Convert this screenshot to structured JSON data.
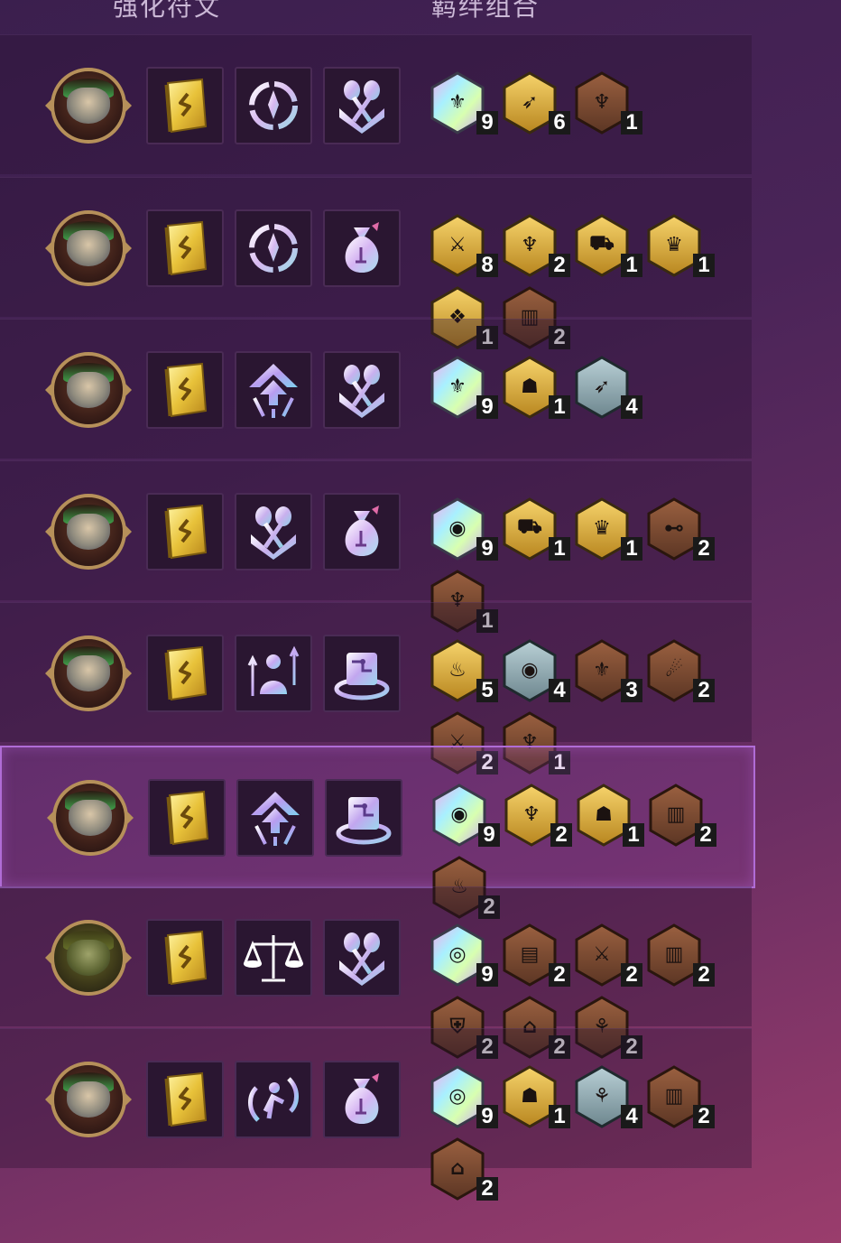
{
  "header": {
    "col_augments": "强化符文",
    "col_traits": "羁绊组合"
  },
  "colors": {
    "prismatic": "prismatic",
    "gold": "#d8a63a",
    "bronze": "#7a4a34",
    "silver": "#8fa6ad"
  },
  "rows": [
    {
      "selected": false,
      "avatar": "champion-portrait",
      "augments": [
        "book-icon",
        "ring-sigil-icon",
        "crossed-tools-icon"
      ],
      "traits": [
        {
          "tier": "prismatic",
          "glyph": "claw",
          "count": "9"
        },
        {
          "tier": "gold",
          "glyph": "feather",
          "count": "6"
        },
        {
          "tier": "bronze",
          "glyph": "beast",
          "count": "1"
        }
      ]
    },
    {
      "selected": false,
      "avatar": "champion-portrait",
      "augments": [
        "book-icon",
        "ring-sigil-icon",
        "money-bag-icon"
      ],
      "traits": [
        {
          "tier": "gold",
          "glyph": "blade",
          "count": "8"
        },
        {
          "tier": "gold",
          "glyph": "beast",
          "count": "2"
        },
        {
          "tier": "gold",
          "glyph": "cannon",
          "count": "1"
        },
        {
          "tier": "gold",
          "glyph": "queen",
          "count": "1"
        },
        {
          "tier": "gold",
          "glyph": "rune",
          "count": "1"
        },
        {
          "tier": "bronze",
          "glyph": "pillars",
          "count": "2"
        }
      ]
    },
    {
      "selected": false,
      "avatar": "champion-portrait",
      "augments": [
        "book-icon",
        "arrow-up-icon",
        "crossed-tools-icon"
      ],
      "traits": [
        {
          "tier": "prismatic",
          "glyph": "claw",
          "count": "9"
        },
        {
          "tier": "gold",
          "glyph": "mask",
          "count": "1"
        },
        {
          "tier": "silver",
          "glyph": "feather",
          "count": "4"
        }
      ]
    },
    {
      "selected": false,
      "avatar": "champion-portrait",
      "augments": [
        "book-icon",
        "crossed-tools-icon",
        "money-bag-icon"
      ],
      "traits": [
        {
          "tier": "prismatic",
          "glyph": "eye",
          "count": "9"
        },
        {
          "tier": "gold",
          "glyph": "cannon",
          "count": "1"
        },
        {
          "tier": "gold",
          "glyph": "queen",
          "count": "1"
        },
        {
          "tier": "bronze",
          "glyph": "dumbbell",
          "count": "2"
        },
        {
          "tier": "bronze",
          "glyph": "beast",
          "count": "1"
        }
      ]
    },
    {
      "selected": false,
      "avatar": "champion-portrait",
      "augments": [
        "book-icon",
        "person-arrows-icon",
        "hat-chip-icon"
      ],
      "traits": [
        {
          "tier": "gold",
          "glyph": "flame",
          "count": "5"
        },
        {
          "tier": "silver",
          "glyph": "eye",
          "count": "4"
        },
        {
          "tier": "bronze",
          "glyph": "claw",
          "count": "3"
        },
        {
          "tier": "bronze",
          "glyph": "comet",
          "count": "2"
        },
        {
          "tier": "bronze",
          "glyph": "blade",
          "count": "2"
        },
        {
          "tier": "bronze",
          "glyph": "beast",
          "count": "1"
        }
      ]
    },
    {
      "selected": true,
      "avatar": "champion-portrait",
      "augments": [
        "book-icon",
        "arrow-up-icon",
        "hat-chip-icon"
      ],
      "traits": [
        {
          "tier": "prismatic",
          "glyph": "eye",
          "count": "9"
        },
        {
          "tier": "gold",
          "glyph": "beast",
          "count": "2"
        },
        {
          "tier": "gold",
          "glyph": "mask",
          "count": "1"
        },
        {
          "tier": "bronze",
          "glyph": "pillars",
          "count": "2"
        },
        {
          "tier": "bronze",
          "glyph": "flame",
          "count": "2"
        }
      ]
    },
    {
      "selected": false,
      "avatar": "champion-portrait-alt",
      "augments": [
        "book-icon",
        "scales-icon",
        "crossed-tools-icon"
      ],
      "traits": [
        {
          "tier": "prismatic",
          "glyph": "swirl",
          "count": "9"
        },
        {
          "tier": "bronze",
          "glyph": "book",
          "count": "2"
        },
        {
          "tier": "bronze",
          "glyph": "blade",
          "count": "2"
        },
        {
          "tier": "bronze",
          "glyph": "pillars",
          "count": "2"
        },
        {
          "tier": "bronze",
          "glyph": "shield",
          "count": "2"
        },
        {
          "tier": "bronze",
          "glyph": "arch",
          "count": "2"
        },
        {
          "tier": "bronze",
          "glyph": "antlers",
          "count": "2"
        }
      ]
    },
    {
      "selected": false,
      "avatar": "champion-portrait",
      "augments": [
        "book-icon",
        "dash-cycle-icon",
        "money-bag-icon"
      ],
      "traits": [
        {
          "tier": "prismatic",
          "glyph": "swirl",
          "count": "9"
        },
        {
          "tier": "gold",
          "glyph": "mask",
          "count": "1"
        },
        {
          "tier": "silver",
          "glyph": "antlers",
          "count": "4"
        },
        {
          "tier": "bronze",
          "glyph": "pillars",
          "count": "2"
        },
        {
          "tier": "bronze",
          "glyph": "arch",
          "count": "2"
        }
      ]
    }
  ]
}
